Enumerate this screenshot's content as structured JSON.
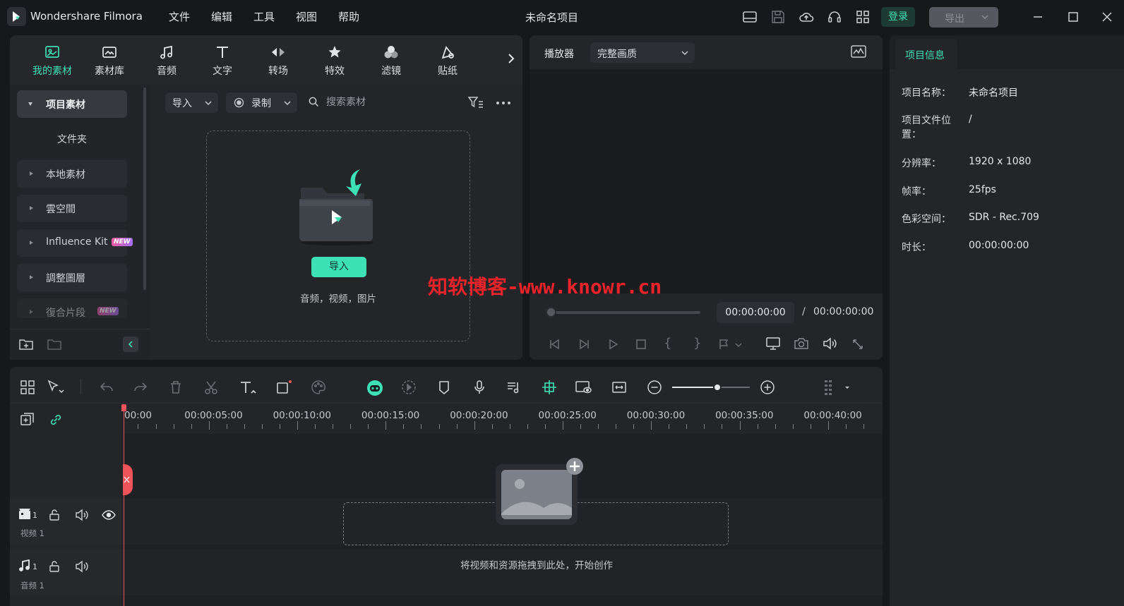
{
  "app": {
    "name": "Wondershare Filmora",
    "project_title": "未命名项目",
    "menu": [
      "文件",
      "编辑",
      "工具",
      "视图",
      "帮助"
    ],
    "login_label": "登录",
    "export_label": "导出"
  },
  "media_tabs": [
    {
      "label": "我的素材",
      "icon": "my-media-icon",
      "active": true
    },
    {
      "label": "素材库",
      "icon": "stock-media-icon",
      "active": false
    },
    {
      "label": "音频",
      "icon": "music-note-icon",
      "active": false
    },
    {
      "label": "文字",
      "icon": "text-icon",
      "active": false
    },
    {
      "label": "转场",
      "icon": "transition-icon",
      "active": false
    },
    {
      "label": "特效",
      "icon": "effects-icon",
      "active": false
    },
    {
      "label": "滤镜",
      "icon": "filter-icon",
      "active": false
    },
    {
      "label": "贴纸",
      "icon": "sticker-icon",
      "active": false
    }
  ],
  "sidebar": {
    "items": [
      {
        "label": "项目素材",
        "expanded": true
      },
      {
        "label": "文件夹"
      },
      {
        "label": "本地素材"
      },
      {
        "label": "雲空間"
      },
      {
        "label": "Influence Kit",
        "badge": "NEW"
      },
      {
        "label": "調整圖層"
      },
      {
        "label": "復合片段",
        "badge": "NEW"
      }
    ]
  },
  "media_toolbar": {
    "import_label": "导入",
    "record_label": "录制",
    "search_placeholder": "搜索素材"
  },
  "drop_zone": {
    "import_button": "导入",
    "hint": "音频，视频，图片"
  },
  "player": {
    "label": "播放器",
    "quality": "完整画质",
    "current_time": "00:00:00:00",
    "separator": "/",
    "total_time": "00:00:00:00"
  },
  "project_info": {
    "tab_label": "项目信息",
    "rows": [
      {
        "key": "项目名称：",
        "value": "未命名项目"
      },
      {
        "key": "项目文件位置：",
        "value": "/"
      },
      {
        "key": "分辨率：",
        "value": "1920 x 1080"
      },
      {
        "key": "帧率：",
        "value": "25fps"
      },
      {
        "key": "色彩空间：",
        "value": "SDR - Rec.709"
      },
      {
        "key": "时长：",
        "value": "00:00:00:00"
      }
    ]
  },
  "timeline": {
    "ruler": [
      "00:00",
      "00:00:05:00",
      "00:00:10:00",
      "00:00:15:00",
      "00:00:20:00",
      "00:00:25:00",
      "00:00:30:00",
      "00:00:35:00",
      "00:00:40:00"
    ],
    "tracks": [
      {
        "label": "视频 1",
        "number": "1"
      },
      {
        "label": "音频 1",
        "number": "1"
      }
    ],
    "drop_hint": "将视频和资源拖拽到此处，开始创作",
    "zoom_level": 0.58
  },
  "watermark": "知软博客-www.knowr.cn",
  "colors": {
    "accent": "#3ee0b5",
    "bg": "#17181c",
    "panel": "#232529",
    "playhead": "#f0545b",
    "watermark": "#e8232a"
  }
}
